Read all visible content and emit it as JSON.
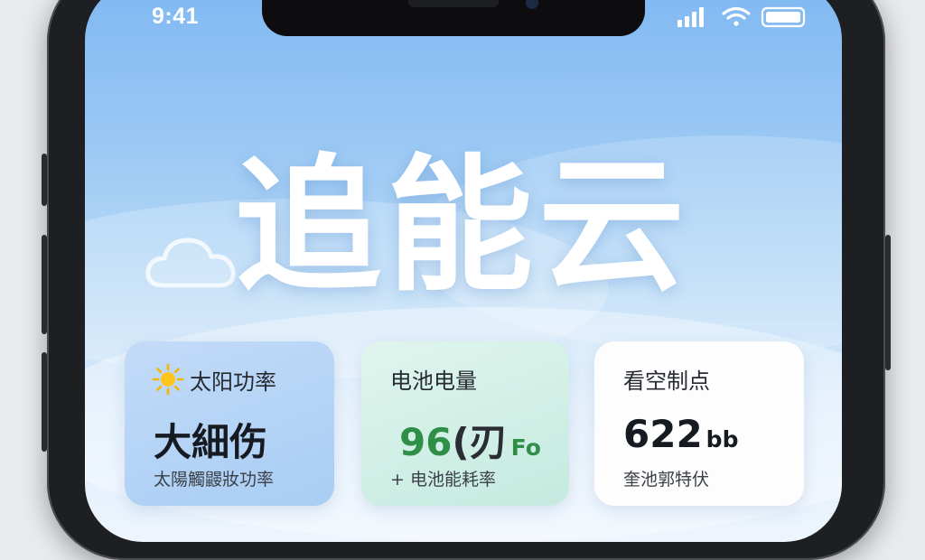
{
  "status_bar": {
    "time": "9:41",
    "icons": [
      "signal-icon",
      "wifi-icon",
      "battery-icon"
    ]
  },
  "app": {
    "title": "追能云"
  },
  "cards": {
    "solar": {
      "label": "太阳功率",
      "icon": "sun-icon",
      "value": "大細伤",
      "sub": "太陽觸鼹妝功率"
    },
    "battery": {
      "label": "电池电量",
      "value_num": "96",
      "value_paren": "(刃",
      "value_unit": "Fo",
      "sub": "+ 电池能耗率"
    },
    "other": {
      "label": "看空制点",
      "value_num": "622",
      "value_unit": "bb",
      "sub": "奎池郭特伏"
    }
  },
  "colors": {
    "battery_green": "#2f8f46",
    "sky_top": "#7fb8f2",
    "sky_bottom": "#eef5fd"
  }
}
